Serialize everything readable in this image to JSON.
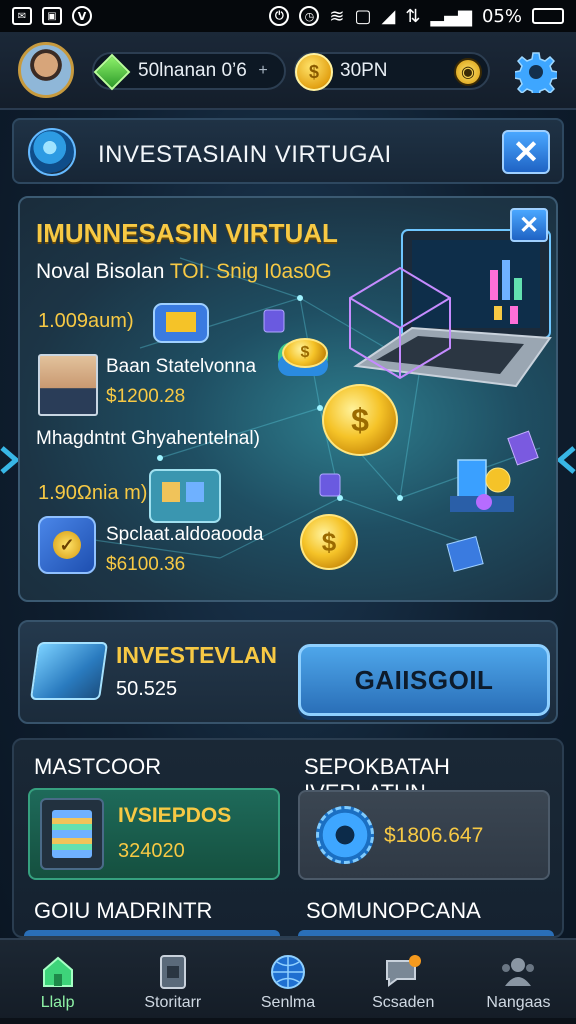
{
  "status_bar": {
    "battery_text": "05%"
  },
  "header": {
    "gem_value": "50lnanan 0’6",
    "gem_plus": "+",
    "coin_value": "30PN",
    "coin_symbol": "$"
  },
  "title_bar": {
    "title": "INVESTASIAIN VIRTUGAI",
    "close_symbol": "✕"
  },
  "main_panel": {
    "title": "IMUNNESASIN VIRTUAL",
    "subtitle_prefix": "Noval Bisolan ",
    "subtitle_highlight": "TOI. Snig I0as0G",
    "close_symbol": "✕",
    "amount_1": "1.009aum)",
    "person_label": "Baan Statelvonna",
    "person_value": "$1200.28",
    "wide_label": "Mhagdntnt Ghyahentelnal)",
    "amount_2": "1.90Ωnia m)",
    "item_label": "Spclaat.aldoaooda",
    "item_value": "$6100.36",
    "coin_symbol": "$"
  },
  "invest_panel": {
    "title": "INVESTEVLAN",
    "value": "50.525",
    "button_label": "GAIISGOIL"
  },
  "lower": {
    "left_heading": "MASTCOOR",
    "right_heading": "SEPOKBATAH IVERLATUN",
    "green_card_title": "IVSIEPDOS",
    "green_card_value": "324020",
    "gray_card_value": "$1806.647",
    "bottom_left_heading": "GOIU MADRINTR",
    "bottom_right_heading": "SOMUNOPCANA"
  },
  "bottom_nav": {
    "items": [
      {
        "label": "Llalp",
        "icon": "home-icon"
      },
      {
        "label": "Storitarr",
        "icon": "phone-icon"
      },
      {
        "label": "Senlma",
        "icon": "globe-icon"
      },
      {
        "label": "Scsaden",
        "icon": "chat-icon"
      },
      {
        "label": "Nangaas",
        "icon": "people-icon"
      }
    ]
  },
  "colors": {
    "accent_gold": "#f7c944",
    "accent_blue": "#2a6fb8",
    "active_green": "#8ef2a6"
  }
}
